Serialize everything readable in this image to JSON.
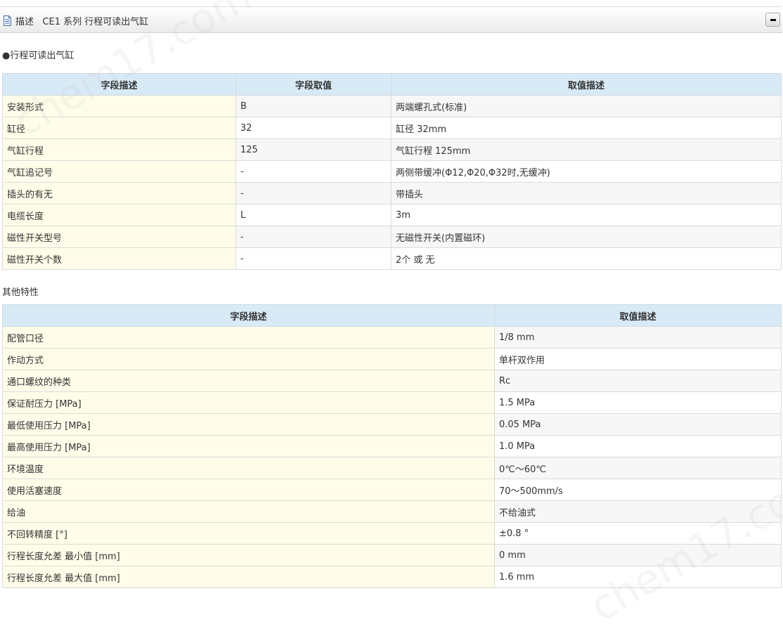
{
  "header": {
    "title": "描述   CE1 系列 行程可读出气缸"
  },
  "section1": {
    "label": "●行程可读出气缸",
    "headers": [
      "字段描述",
      "字段取值",
      "取值描述"
    ],
    "rows": [
      [
        "安装形式",
        "B",
        "两端螺孔式(标准)"
      ],
      [
        "缸径",
        "32",
        "缸径 32mm"
      ],
      [
        "气缸行程",
        "125",
        "气缸行程 125mm"
      ],
      [
        "气缸追记号",
        "-",
        "两侧带缓冲(Φ12,Φ20,Φ32时,无缓冲)"
      ],
      [
        "插头的有无",
        "-",
        "带插头"
      ],
      [
        "电缆长度",
        "L",
        "3m"
      ],
      [
        "磁性开关型号",
        "-",
        "无磁性开关(内置磁环)"
      ],
      [
        "磁性开关个数",
        "-",
        "2个 或 无"
      ]
    ]
  },
  "section2": {
    "label": "其他特性",
    "headers": [
      "字段描述",
      "取值描述"
    ],
    "rows": [
      [
        "配管口径",
        "1/8 mm"
      ],
      [
        "作动方式",
        "单杆双作用"
      ],
      [
        "通口螺纹的种类",
        "Rc"
      ],
      [
        "保证耐压力 [MPa]",
        "1.5 MPa"
      ],
      [
        "最低使用压力 [MPa]",
        "0.05 MPa"
      ],
      [
        "最高使用压力 [MPa]",
        "1.0 MPa"
      ],
      [
        "环境温度",
        "0℃～60℃"
      ],
      [
        "使用活塞速度",
        "70～500mm/s"
      ],
      [
        "给油",
        "不给油式"
      ],
      [
        "不回转精度 [°]",
        "±0.8 °"
      ],
      [
        "行程长度允差 最小值 [mm]",
        "0 mm"
      ],
      [
        "行程长度允差 最大值 [mm]",
        "1.6 mm"
      ]
    ]
  },
  "watermark": {
    "text": "chem17.com"
  }
}
